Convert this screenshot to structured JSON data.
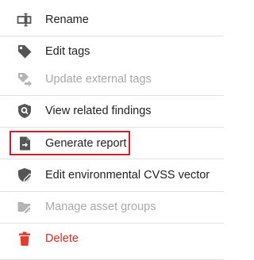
{
  "menu": {
    "items": [
      {
        "label": "Rename",
        "icon": "rename-icon",
        "state": "enabled"
      },
      {
        "label": "Edit tags",
        "icon": "tag-icon",
        "state": "enabled"
      },
      {
        "label": "Update external tags",
        "icon": "tag-arrow-icon",
        "state": "disabled"
      },
      {
        "label": "View related findings",
        "icon": "shield-search-icon",
        "state": "enabled"
      },
      {
        "label": "Generate report",
        "icon": "file-export-icon",
        "state": "enabled",
        "highlighted": true
      },
      {
        "label": "Edit environmental CVSS vector",
        "icon": "shield-edit-icon",
        "state": "enabled"
      },
      {
        "label": "Manage asset groups",
        "icon": "folder-edit-icon",
        "state": "disabled"
      },
      {
        "label": "Delete",
        "icon": "trash-icon",
        "state": "danger"
      }
    ]
  },
  "colors": {
    "text": "#222222",
    "icon": "#555555",
    "disabled": "#a8a8a8",
    "danger": "#d62a1e",
    "highlight_border": "#d01c24",
    "divider": "#e2e2e2"
  }
}
